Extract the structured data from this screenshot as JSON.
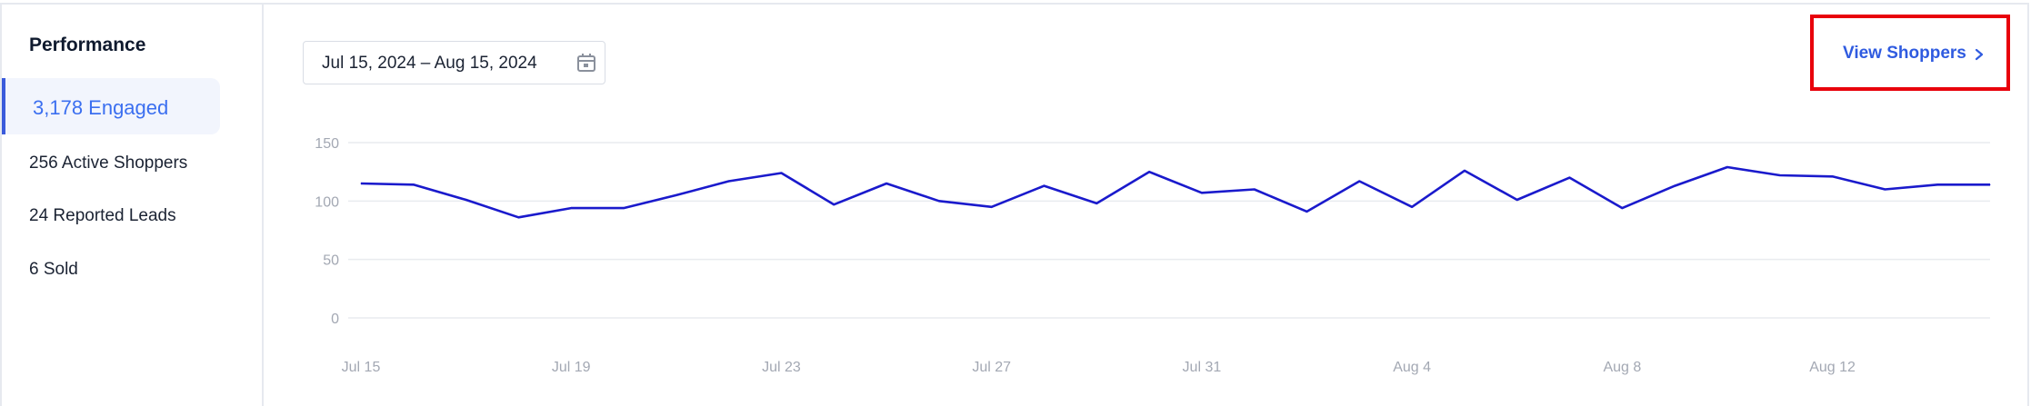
{
  "sidebar": {
    "title": "Performance",
    "items": [
      {
        "label": "3,178 Engaged",
        "active": true
      },
      {
        "label": "256 Active Shoppers"
      },
      {
        "label": "24 Reported Leads"
      },
      {
        "label": "6 Sold"
      }
    ]
  },
  "date_range": {
    "value": "Jul 15, 2024 – Aug 15, 2024",
    "icon": "calendar-icon"
  },
  "view_shoppers": {
    "label": "View Shoppers",
    "icon": "chevron-right-icon",
    "highlight_color": "#e8000b"
  },
  "colors": {
    "accent": "#3b6ff0",
    "line": "#1a1acc",
    "grid": "#e9ebef"
  },
  "chart_data": {
    "type": "line",
    "x_tick_labels": [
      "Jul 15",
      "Jul 19",
      "Jul 23",
      "Jul 27",
      "Jul 31",
      "Aug 4",
      "Aug 8",
      "Aug 12"
    ],
    "y_tick_labels": [
      "0",
      "50",
      "100",
      "150"
    ],
    "ylim": [
      0,
      150
    ],
    "grid": true,
    "x": [
      "Jul 15",
      "Jul 16",
      "Jul 17",
      "Jul 18",
      "Jul 19",
      "Jul 20",
      "Jul 21",
      "Jul 22",
      "Jul 23",
      "Jul 24",
      "Jul 25",
      "Jul 26",
      "Jul 27",
      "Jul 28",
      "Jul 29",
      "Jul 30",
      "Jul 31",
      "Aug 1",
      "Aug 2",
      "Aug 3",
      "Aug 4",
      "Aug 5",
      "Aug 6",
      "Aug 7",
      "Aug 8",
      "Aug 9",
      "Aug 10",
      "Aug 11",
      "Aug 12",
      "Aug 13",
      "Aug 14",
      "Aug 15"
    ],
    "series": [
      {
        "values": [
          115,
          114,
          101,
          86,
          94,
          94,
          105,
          117,
          124,
          97,
          115,
          100,
          95,
          113,
          98,
          125,
          107,
          110,
          91,
          117,
          95,
          126,
          101,
          120,
          94,
          113,
          129,
          122,
          121,
          110,
          114,
          114
        ]
      }
    ]
  }
}
